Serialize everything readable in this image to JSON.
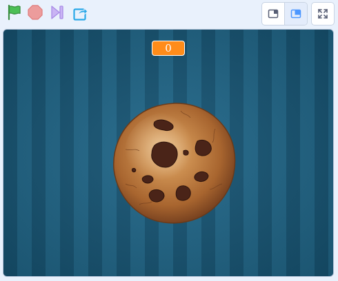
{
  "toolbar": {
    "icons": {
      "green_flag": "green-flag-icon",
      "stop": "stop-icon",
      "turbo": "turbo-mode-icon",
      "share": "share-icon",
      "small_stage": "small-stage-icon",
      "normal_stage": "normal-stage-icon",
      "fullscreen": "fullscreen-icon"
    },
    "active_view": "normal-stage"
  },
  "stage": {
    "variable_monitor": {
      "value": "0"
    },
    "sprite": {
      "name": "cookie"
    }
  },
  "colors": {
    "flag_green": "#4cbf56",
    "stop_red": "#ec9c9c",
    "turbo_purple": "#c2a8f0",
    "share_blue": "#0fbd8c",
    "accent_blue": "#4c97ff",
    "monitor_orange": "#ff8c1a",
    "stage_blue": "#1d6284"
  }
}
